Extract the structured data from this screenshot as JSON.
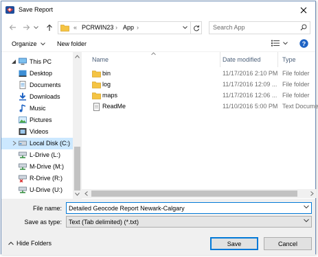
{
  "window": {
    "title": "Save Report"
  },
  "address": {
    "prefix": "«",
    "crumbs": [
      "PCRWIN23",
      "App"
    ]
  },
  "search": {
    "placeholder": "Search App"
  },
  "toolbar": {
    "organize_label": "Organize",
    "new_folder_label": "New folder"
  },
  "nav": {
    "items": [
      {
        "label": "This PC",
        "icon": "computer-icon"
      },
      {
        "label": "Desktop",
        "icon": "desktop-icon"
      },
      {
        "label": "Documents",
        "icon": "documents-icon"
      },
      {
        "label": "Downloads",
        "icon": "downloads-icon"
      },
      {
        "label": "Music",
        "icon": "music-icon"
      },
      {
        "label": "Pictures",
        "icon": "pictures-icon"
      },
      {
        "label": "Videos",
        "icon": "videos-icon"
      },
      {
        "label": "Local Disk (C:)",
        "icon": "local-disk-icon",
        "selected": true
      },
      {
        "label": "L-Drive (L:)",
        "icon": "network-drive-icon"
      },
      {
        "label": "M-Drive (M:)",
        "icon": "network-drive-icon"
      },
      {
        "label": "R-Drive (R:)",
        "icon": "disconnected-drive-icon"
      },
      {
        "label": "U-Drive (U:)",
        "icon": "network-drive-icon"
      }
    ]
  },
  "columns": {
    "name": "Name",
    "date": "Date modified",
    "type": "Type"
  },
  "files": [
    {
      "name": "bin",
      "date": "11/17/2016 2:10 PM",
      "type": "File folder",
      "icon": "folder-icon"
    },
    {
      "name": "log",
      "date": "11/17/2016 12:09 ...",
      "type": "File folder",
      "icon": "folder-icon"
    },
    {
      "name": "maps",
      "date": "11/17/2016 12:06 ...",
      "type": "File folder",
      "icon": "folder-icon"
    },
    {
      "name": "ReadMe",
      "date": "11/10/2016 5:00 PM",
      "type": "Text Docume",
      "icon": "text-document-icon"
    }
  ],
  "form": {
    "file_name_label": "File name:",
    "file_name_value": "Detailed Geocode Report Newark-Calgary",
    "save_type_label": "Save as type:",
    "save_type_value": "Text (Tab delimited) (*.txt)"
  },
  "buttons": {
    "hide_folders": "Hide Folders",
    "save": "Save",
    "cancel": "Cancel"
  },
  "colors": {
    "accent": "#0078d7",
    "selection": "#cce8ff",
    "folder": "#f5c443"
  }
}
